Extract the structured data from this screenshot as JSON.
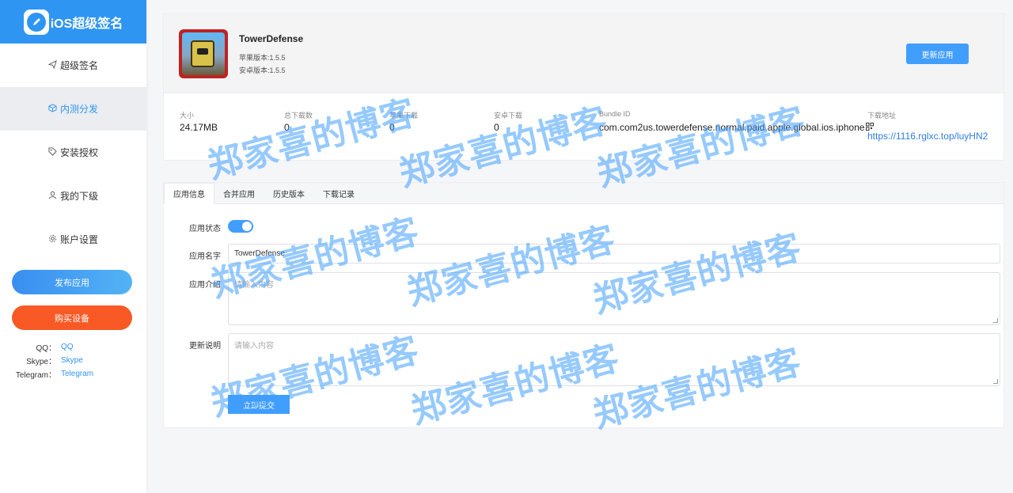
{
  "sidebar": {
    "logo_text": "iOS超级签名",
    "nav": [
      {
        "label": "超级签名",
        "icon": "send-icon"
      },
      {
        "label": "内测分发",
        "icon": "box-icon"
      },
      {
        "label": "安装授权",
        "icon": "tag-icon"
      },
      {
        "label": "我的下级",
        "icon": "user-icon"
      },
      {
        "label": "账户设置",
        "icon": "gear-icon"
      }
    ],
    "publish_label": "发布应用",
    "buy_label": "购买设备",
    "contacts": [
      {
        "label": "QQ：",
        "value": "QQ"
      },
      {
        "label": "Skype：",
        "value": "Skype"
      },
      {
        "label": "Telegram：",
        "value": "Telegram"
      }
    ]
  },
  "app": {
    "name": "TowerDefense",
    "ios_version": "苹果版本:1.5.5",
    "android_version": "安卓版本:1.5.5",
    "update_label": "更新应用"
  },
  "stats": {
    "size_label": "大小",
    "size_value": "24.17MB",
    "total_label": "总下载数",
    "total_value": "0",
    "ios_label": "苹果下载",
    "ios_value": "0",
    "android_label": "安卓下载",
    "android_value": "0",
    "bundle_label": "Bundle ID",
    "bundle_value": "com.com2us.towerdefense.normal.paid.apple.global.ios.iphone",
    "download_label": "下载地址",
    "download_value": "https://1116.rglxc.top/luyHN2"
  },
  "tabs": [
    "应用信息",
    "合并应用",
    "历史版本",
    "下载记录"
  ],
  "form": {
    "status_label": "应用状态",
    "name_label": "应用名字",
    "name_value": "TowerDefense",
    "intro_label": "应用介绍",
    "intro_placeholder": "请输入内容",
    "changelog_label": "更新说明",
    "changelog_placeholder": "请输入内容",
    "submit_label": "立即提交"
  },
  "watermark": "郑家喜的博客",
  "colors": {
    "primary": "#409eff",
    "brand": "#2f95f2",
    "buy": "#f95a25"
  }
}
